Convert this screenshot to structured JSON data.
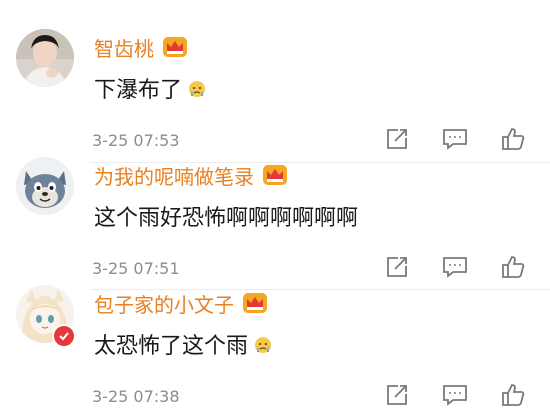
{
  "comments": [
    {
      "username": "智齿桃",
      "text": "下瀑布了",
      "time": "3-25 07:53",
      "avatar_icon": "man-avatar",
      "has_emoji": true
    },
    {
      "username": "为我的呢喃做笔录",
      "text": "这个雨好恐怖啊啊啊啊啊啊",
      "time": "3-25 07:51",
      "avatar_icon": "cartoon-cat-avatar",
      "has_emoji": false
    },
    {
      "username": "包子家的小文子",
      "text": "太恐怖了这个雨",
      "time": "3-25 07:38",
      "avatar_icon": "anime-girl-avatar",
      "has_emoji": true
    }
  ],
  "colors": {
    "username": "#e98122",
    "text": "#1a1a1a",
    "time": "#8c8c8c",
    "icon": "#7a7a7a",
    "crown": "#f5a623"
  },
  "icons": {
    "crown": "crown-icon",
    "repost": "repost-icon",
    "comment": "comment-icon",
    "like": "like-icon",
    "emoji": "crying-emoji-icon"
  }
}
